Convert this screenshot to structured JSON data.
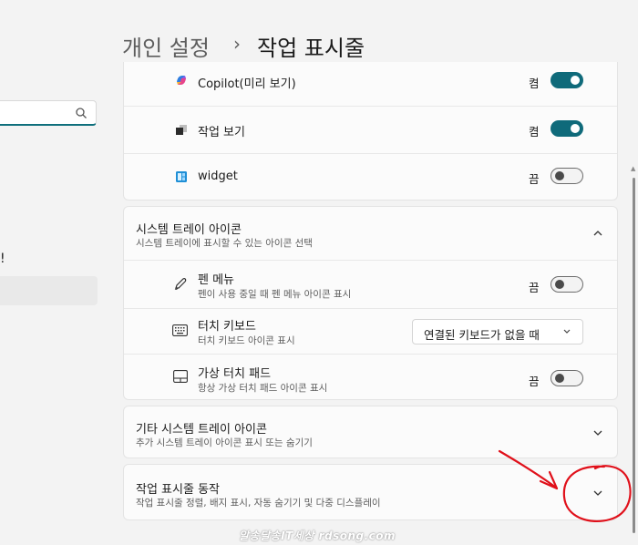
{
  "breadcrumb": {
    "parent": "개인 설정",
    "separator": "›",
    "current": "작업 표시줄"
  },
  "nav": {
    "search_value": "",
    "fragment": "!"
  },
  "taskbar_items": [
    {
      "icon": "copilot-icon",
      "label": "Copilot(미리 보기)",
      "state": "켬",
      "on": true
    },
    {
      "icon": "task-view-icon",
      "label": "작업 보기",
      "state": "켬",
      "on": true
    },
    {
      "icon": "widget-icon",
      "label": "widget",
      "state": "끔",
      "on": false
    }
  ],
  "system_tray": {
    "title": "시스템 트레이 아이콘",
    "subtitle": "시스템 트레이에 표시할 수 있는 아이콘 선택",
    "items": [
      {
        "icon": "pen-icon",
        "label": "펜 메뉴",
        "sub": "펜이 사용 중일 때 펜 메뉴 아이콘 표시",
        "state": "끔",
        "on": false
      },
      {
        "icon": "keyboard-icon",
        "label": "터치 키보드",
        "sub": "터치 키보드 아이콘 표시",
        "dropdown": "연결된 키보드가 없을 때"
      },
      {
        "icon": "touchpad-icon",
        "label": "가상 터치 패드",
        "sub": "항상 가상 터치 패드 아이콘 표시",
        "state": "끔",
        "on": false
      }
    ]
  },
  "other_tray": {
    "title": "기타 시스템 트레이 아이콘",
    "subtitle": "추가 시스템 트레이 아이콘 표시 또는 숨기기"
  },
  "behaviors": {
    "title": "작업 표시줄 동작",
    "subtitle": "작업 표시줄 정렬, 배지 표시, 자동 숨기기 및 다중 디스플레이"
  },
  "watermark": "알송달송IT세상 rdsong.com",
  "colors": {
    "accent": "#0f6a7a",
    "annotation": "#e0101a"
  }
}
